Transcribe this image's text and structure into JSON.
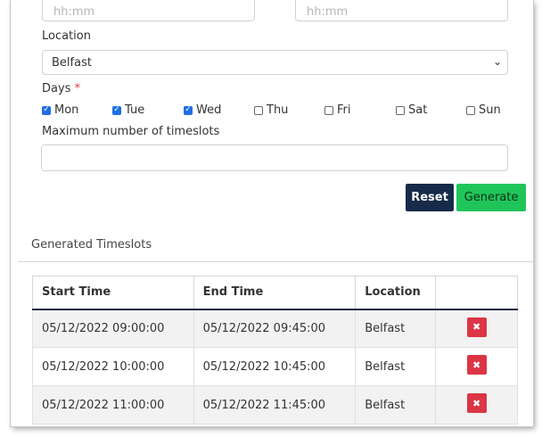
{
  "form": {
    "top_placeholders": [
      "hh:mm",
      "hh:mm"
    ],
    "location_label": "Location",
    "location_value": "Belfast",
    "days_label": "Days",
    "required_mark": "*",
    "days": [
      {
        "label": "Mon",
        "checked": true
      },
      {
        "label": "Tue",
        "checked": true
      },
      {
        "label": "Wed",
        "checked": true
      },
      {
        "label": "Thu",
        "checked": false
      },
      {
        "label": "Fri",
        "checked": false
      },
      {
        "label": "Sat",
        "checked": false
      },
      {
        "label": "Sun",
        "checked": false
      }
    ],
    "max_timeslots_label": "Maximum number of timeslots",
    "max_timeslots_value": "",
    "reset_label": "Reset",
    "generate_label": "Generate"
  },
  "timeslots": {
    "title": "Generated Timeslots",
    "columns": [
      "Start Time",
      "End Time",
      "Location",
      ""
    ],
    "rows": [
      {
        "start": "05/12/2022 09:00:00",
        "end": "05/12/2022 09:45:00",
        "location": "Belfast"
      },
      {
        "start": "05/12/2022 10:00:00",
        "end": "05/12/2022 10:45:00",
        "location": "Belfast"
      },
      {
        "start": "05/12/2022 11:00:00",
        "end": "05/12/2022 11:45:00",
        "location": "Belfast"
      }
    ],
    "delete_glyph": "✖"
  },
  "colors": {
    "reset_bg": "#182a4a",
    "generate_bg": "#20c55a",
    "delete_bg": "#dc3545",
    "checkbox_on": "#1f6fe5"
  }
}
